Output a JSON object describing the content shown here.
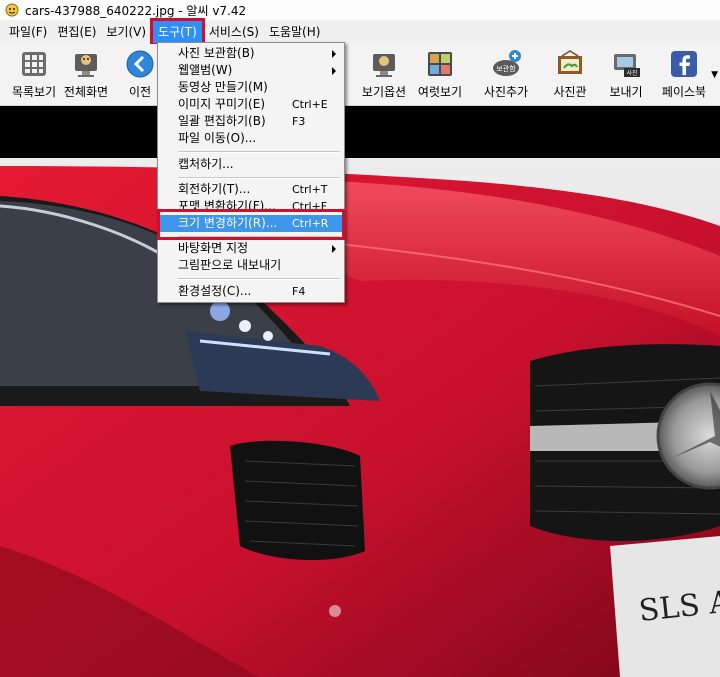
{
  "window": {
    "title": "cars-437988_640222.jpg - 알씨 v7.42"
  },
  "menubar": {
    "items": [
      "파일(F)",
      "편집(E)",
      "보기(V)",
      "도구(T)",
      "서비스(S)",
      "도움말(H)"
    ],
    "active": "도구(T)"
  },
  "toolbar": {
    "buttons": [
      {
        "label": "목록보기",
        "icon": "list-view-icon"
      },
      {
        "label": "전체화면",
        "icon": "fullscreen-icon"
      },
      {
        "label": "이전",
        "icon": "previous-icon"
      },
      {
        "label": "보기옵션",
        "icon": "view-options-icon"
      },
      {
        "label": "여럿보기",
        "icon": "multi-view-icon"
      },
      {
        "label": "사진추가",
        "icon": "add-photo-icon",
        "badge": "보관함"
      },
      {
        "label": "사진관",
        "icon": "photo-studio-icon"
      },
      {
        "label": "보내기",
        "icon": "send-icon",
        "badge": "사진"
      },
      {
        "label": "페이스북",
        "icon": "facebook-icon"
      }
    ]
  },
  "tools_menu": {
    "items": [
      {
        "label": "사진 보관함(B)",
        "shortcut": "",
        "submenu": true
      },
      {
        "label": "웹앨범(W)",
        "shortcut": "",
        "submenu": true
      },
      {
        "label": "동영상 만들기(M)",
        "shortcut": "",
        "submenu": false
      },
      {
        "label": "이미지 꾸미기(E)",
        "shortcut": "Ctrl+E",
        "submenu": false
      },
      {
        "label": "일괄 편집하기(B)",
        "shortcut": "F3",
        "submenu": false
      },
      {
        "label": "파일 이동(O)...",
        "shortcut": "",
        "submenu": false
      },
      {
        "label": "캡처하기...",
        "shortcut": "",
        "submenu": false
      },
      {
        "label": "회전하기(T)...",
        "shortcut": "Ctrl+T",
        "submenu": false
      },
      {
        "label": "포맷 변환하기(F)...",
        "shortcut": "Ctrl+F",
        "submenu": false
      },
      {
        "label": "크기 변경하기(R)...",
        "shortcut": "Ctrl+R",
        "submenu": false,
        "highlighted": true
      },
      {
        "label": "바탕화면 지정",
        "shortcut": "",
        "submenu": true
      },
      {
        "label": "그림판으로 내보내기",
        "shortcut": "",
        "submenu": false
      },
      {
        "label": "환경설정(C)...",
        "shortcut": "F4",
        "submenu": false
      }
    ]
  },
  "photo": {
    "plate_text": "SLS AM"
  },
  "colors": {
    "accent": "#2f8ff5",
    "highlight_box": "#d10f2d",
    "menu_highlight": "#3d96e8",
    "car_red": "#c8102e"
  }
}
